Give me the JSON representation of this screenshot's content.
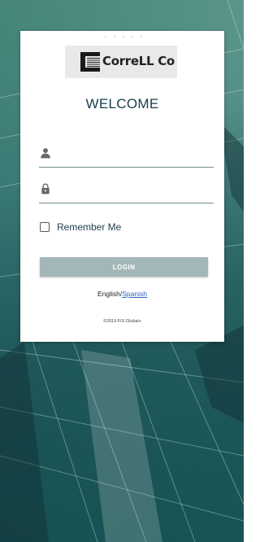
{
  "brand": {
    "logo_text": "CorreLL Co"
  },
  "welcome_title": "WELCOME",
  "username": {
    "icon": "person-icon",
    "value": "",
    "placeholder": ""
  },
  "password": {
    "icon": "lock-icon",
    "value": "",
    "placeholder": ""
  },
  "remember_me": {
    "label": "Remember Me",
    "checked": false
  },
  "login_button": {
    "label": "LOGIN",
    "color": "#a4b7b8"
  },
  "language": {
    "current": "English",
    "separator": "/",
    "alternate": "Spanish"
  },
  "footer": {
    "copyright": "©2019 FIS Global+"
  },
  "colors": {
    "title": "#17404a",
    "field_underline": "#6c8f8f",
    "link": "#2a62c9"
  }
}
